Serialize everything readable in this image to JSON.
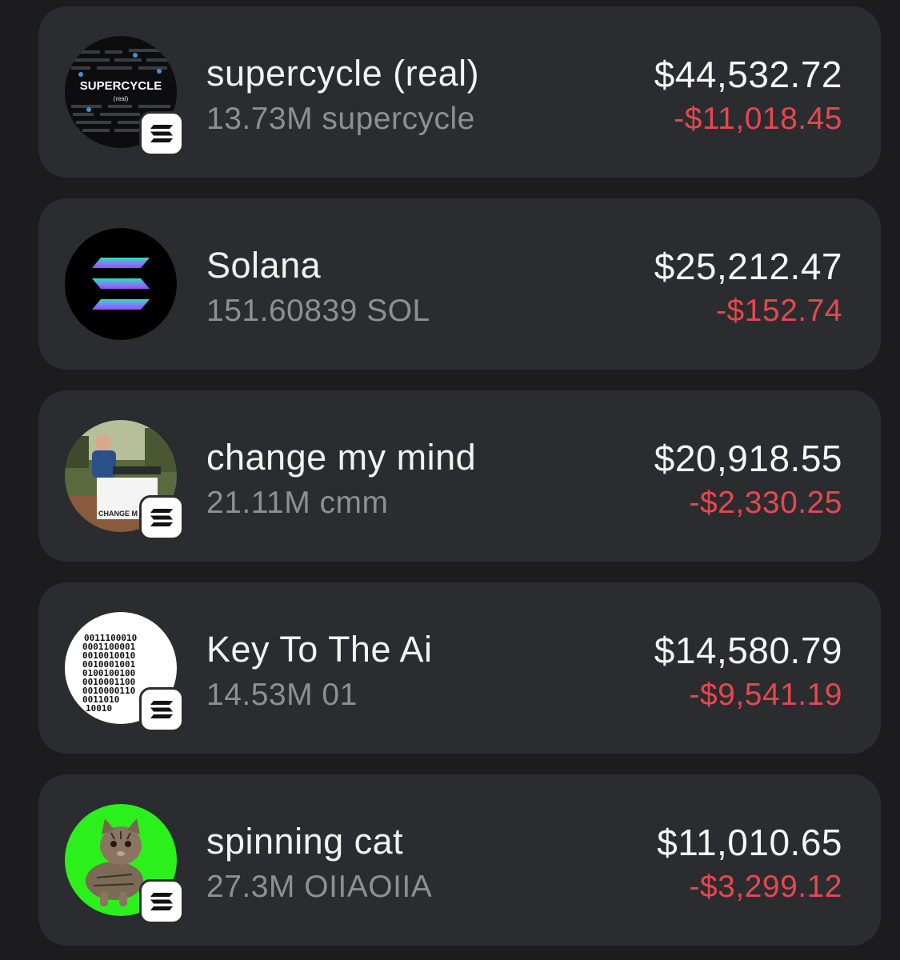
{
  "colors": {
    "background": "#1c1c1e",
    "card": "#2b2c30",
    "primary_text": "#f2f2f2",
    "secondary_text": "#8e8e93",
    "negative": "#e5484d"
  },
  "assets": [
    {
      "name": "supercycle (real)",
      "amount": "13.73M supercycle",
      "value": "$44,532.72",
      "change": "-$11,018.45",
      "icon": "supercycle-token-icon",
      "icon_text": "SUPERCYCLE",
      "icon_subtext": "(real)",
      "has_chain_badge": true
    },
    {
      "name": "Solana",
      "amount": "151.60839 SOL",
      "value": "$25,212.47",
      "change": "-$152.74",
      "icon": "solana-logo-icon",
      "has_chain_badge": false
    },
    {
      "name": "change my mind",
      "amount": "21.11M cmm",
      "value": "$20,918.55",
      "change": "-$2,330.25",
      "icon": "change-my-mind-token-icon",
      "icon_text": "CHANGE M",
      "has_chain_badge": true
    },
    {
      "name": "Key To The Ai",
      "amount": "14.53M 01",
      "value": "$14,580.79",
      "change": "-$9,541.19",
      "icon": "binary-code-token-icon",
      "has_chain_badge": true
    },
    {
      "name": "spinning cat",
      "amount": "27.3M OIIAOIIA",
      "value": "$11,010.65",
      "change": "-$3,299.12",
      "icon": "spinning-cat-token-icon",
      "has_chain_badge": true
    }
  ]
}
